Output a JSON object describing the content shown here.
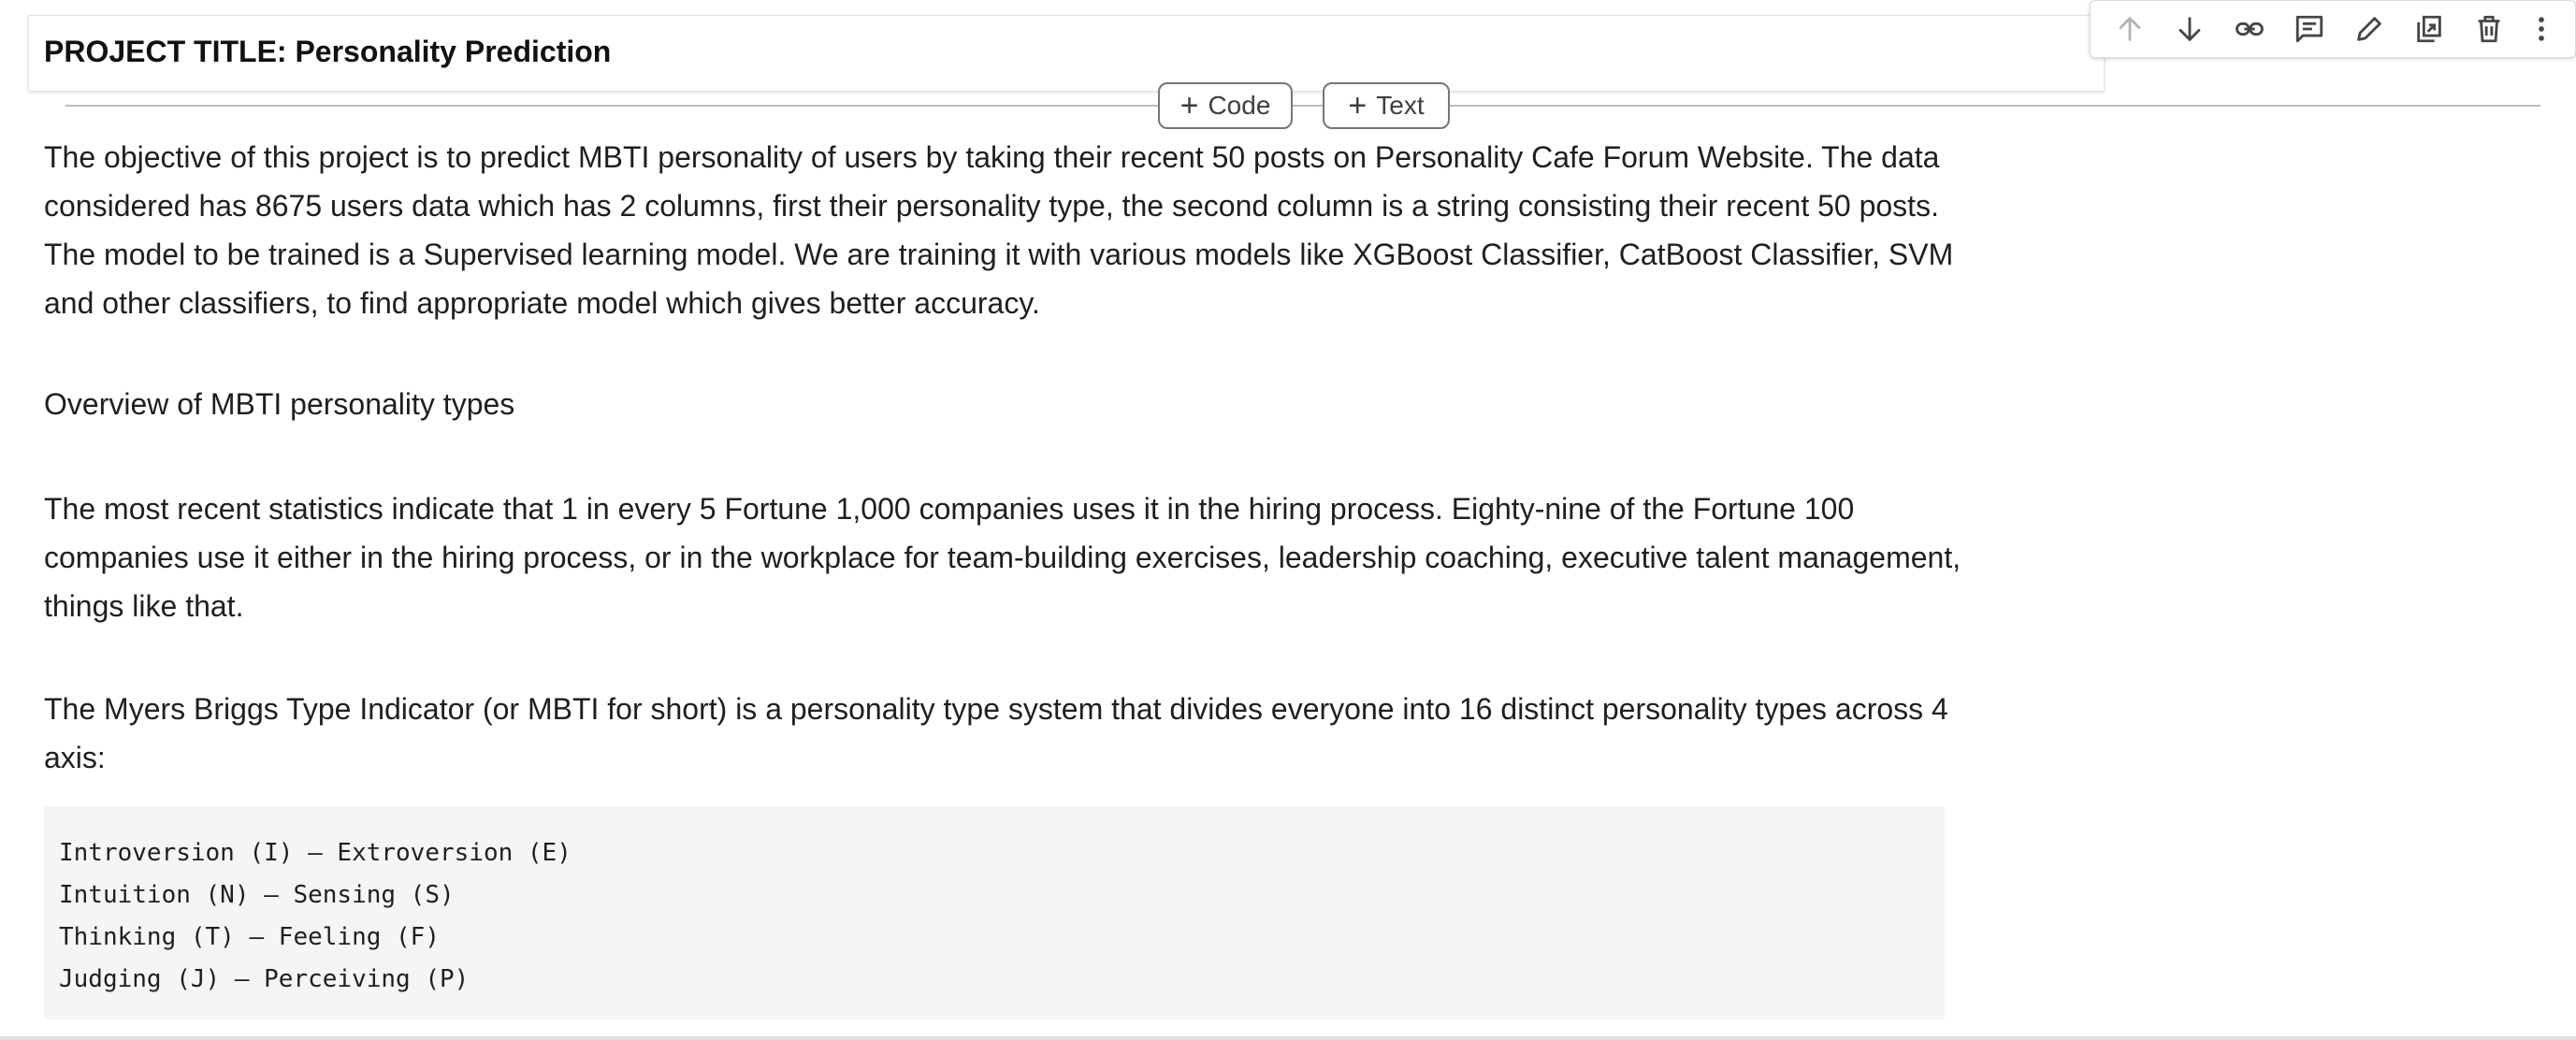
{
  "header": {
    "title": "PROJECT TITLE: Personality Prediction"
  },
  "toolbar": {
    "icons": [
      "arrow-up-icon",
      "arrow-down-icon",
      "link-icon",
      "comment-icon",
      "pencil-icon",
      "mirror-cell-icon",
      "trash-icon",
      "more-vert-icon"
    ]
  },
  "add_buttons": {
    "code_label": "Code",
    "text_label": "Text"
  },
  "content": {
    "p1": "The objective of this project is to predict MBTI personality of users by taking their recent 50 posts on Personality Cafe Forum Website. The data considered has 8675 users data which has 2 columns, first their personality type, the second column is a string consisting their recent 50 posts. The model to be trained is a Supervised learning model. We are training it with various models like XGBoost Classifier, CatBoost Classifier, SVM and other classifiers, to find appropriate model which gives better accuracy.",
    "p2": "Overview of MBTI personality types",
    "p3": "The most recent statistics indicate that 1 in every 5 Fortune 1,000 companies uses it in the hiring process. Eighty-nine of the Fortune 100 companies use it either in the hiring process, or in the workplace for team-building exercises, leadership coaching, executive talent management, things like that.",
    "p4": "The Myers Briggs Type Indicator (or MBTI for short) is a personality type system that divides everyone into 16 distinct personality types across 4 axis:",
    "code_lines": [
      "Introversion (I) – Extroversion (E)",
      "Intuition (N) – Sensing (S)",
      "Thinking (T) – Feeling (F)",
      "Judging (J) – Perceiving (P)"
    ]
  },
  "colors": {
    "icon": "#444746",
    "icon_disabled": "#9aa0a6",
    "code_bg": "#f5f5f5"
  }
}
